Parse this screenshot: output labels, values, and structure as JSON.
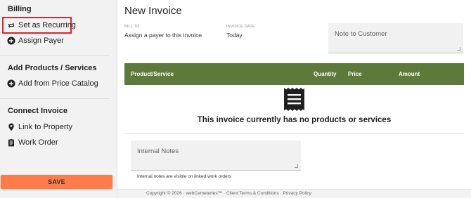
{
  "sidebar": {
    "billing": {
      "heading": "Billing",
      "set_recurring": "Set as Recurring",
      "assign_payer": "Assign Payer"
    },
    "products": {
      "heading": "Add Products / Services",
      "add_from_catalog": "Add from Price Catalog"
    },
    "connect": {
      "heading": "Connect Invoice",
      "link_property": "Link to Property",
      "work_order": "Work Order"
    },
    "save_label": "SAVE"
  },
  "main": {
    "title": "New Invoice",
    "bill_to": {
      "label": "BILL TO",
      "value": "Assign a payer to this invoice"
    },
    "invoice_date": {
      "label": "INVOICE DATE",
      "value": "Today"
    },
    "note_placeholder": "Note to Customer",
    "table": {
      "columns": [
        "Product/Service",
        "Quantity",
        "Price",
        "Amount"
      ],
      "empty_message": "This invoice currently has no products or services"
    },
    "internal_notes_placeholder": "Internal Notes",
    "internal_notes_help": "Internal notes are visible on linked work orders"
  },
  "footer": {
    "copyright": "Copyright © 2026 ·",
    "brand": "webCemeteries™",
    "sep1": "·",
    "terms": "Client Terms & Conditions",
    "sep2": "·",
    "privacy": "Privacy Policy"
  },
  "colors": {
    "sidebar_bg": "#f2f2f2",
    "table_header": "#5e7a3a",
    "save_button": "#ff7c4a",
    "highlight": "#e0222b"
  },
  "icons": {
    "recurring": "repeat-icon",
    "assign_payer": "add-circle-icon",
    "add_catalog": "add-circle-icon",
    "link_property": "map-pin-icon",
    "work_order": "clipboard-icon",
    "empty": "receipt-icon"
  }
}
